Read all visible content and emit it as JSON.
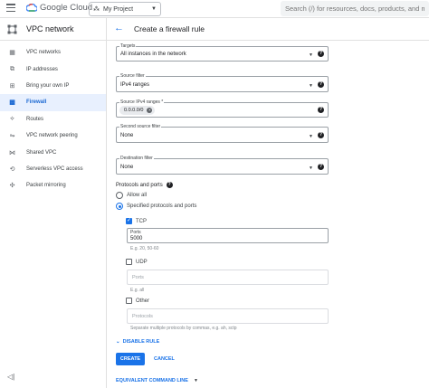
{
  "topbar": {
    "logo_text": "Google Cloud",
    "project_label": "My Project",
    "search_placeholder": "Search (/) for resources, docs, products, and more"
  },
  "sidebar": {
    "title": "VPC network",
    "items": [
      {
        "label": "VPC networks",
        "icon": "network-icon"
      },
      {
        "label": "IP addresses",
        "icon": "ip-icon"
      },
      {
        "label": "Bring your own IP",
        "icon": "byoip-icon"
      },
      {
        "label": "Firewall",
        "icon": "firewall-icon",
        "active": true
      },
      {
        "label": "Routes",
        "icon": "routes-icon"
      },
      {
        "label": "VPC network peering",
        "icon": "peering-icon"
      },
      {
        "label": "Shared VPC",
        "icon": "shared-vpc-icon"
      },
      {
        "label": "Serverless VPC access",
        "icon": "serverless-icon"
      },
      {
        "label": "Packet mirroring",
        "icon": "mirroring-icon"
      }
    ]
  },
  "page": {
    "title": "Create a firewall rule"
  },
  "form": {
    "targets": {
      "label": "Targets",
      "value": "All instances in the network"
    },
    "source_filter": {
      "label": "Source filter",
      "value": "IPv4 ranges"
    },
    "source_ranges": {
      "label": "Source IPv4 ranges *",
      "chip": "0.0.0.0/0"
    },
    "second_source_filter": {
      "label": "Second source filter",
      "value": "None"
    },
    "destination_filter": {
      "label": "Destination filter",
      "value": "None"
    },
    "protocols_label": "Protocols and ports",
    "allow_all": "Allow all",
    "specified": "Specified protocols and ports",
    "tcp": {
      "label": "TCP",
      "ports_label": "Ports",
      "ports_value": "5000",
      "hint": "E.g. 20, 50-60"
    },
    "udp": {
      "label": "UDP",
      "ports_placeholder": "Ports",
      "hint": "E.g. all"
    },
    "other": {
      "label": "Other",
      "placeholder": "Protocols",
      "hint": "Separate multiple protocols by commas, e.g. ah, sctp"
    },
    "disable_rule": "DISABLE RULE",
    "create": "CREATE",
    "cancel": "CANCEL",
    "equivalent": "EQUIVALENT COMMAND LINE"
  }
}
